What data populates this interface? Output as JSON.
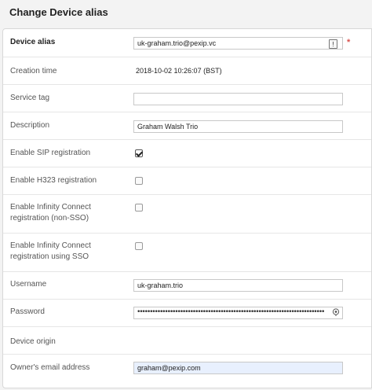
{
  "page": {
    "title": "Change Device alias"
  },
  "form": {
    "device_alias": {
      "label": "Device alias",
      "value": "uk-graham.trio@pexip.vc",
      "required_mark": "*"
    },
    "creation_time": {
      "label": "Creation time",
      "value": "2018-10-02 10:26:07 (BST)"
    },
    "service_tag": {
      "label": "Service tag",
      "value": ""
    },
    "description": {
      "label": "Description",
      "value": "Graham Walsh Trio"
    },
    "enable_sip": {
      "label": "Enable SIP registration",
      "checked": true
    },
    "enable_h323": {
      "label": "Enable H323 registration",
      "checked": false
    },
    "enable_ic_non_sso": {
      "label": "Enable Infinity Connect registration (non-SSO)",
      "checked": false
    },
    "enable_ic_sso": {
      "label": "Enable Infinity Connect registration using SSO",
      "checked": false
    },
    "username": {
      "label": "Username",
      "value": "uk-graham.trio"
    },
    "password": {
      "label": "Password",
      "masked": "••••••••••••••••••••••••••••••••••••••••••••••••••••••••••••••••••••••••••"
    },
    "device_origin": {
      "label": "Device origin",
      "value": ""
    },
    "owner_email": {
      "label": "Owner's email address",
      "value": "graham@pexip.com"
    }
  },
  "icons": {
    "alias_button": "exclamation-icon",
    "password_toggle": "eye-icon"
  },
  "colors": {
    "required": "#d9534f",
    "autofill": "#e8f0fe"
  }
}
